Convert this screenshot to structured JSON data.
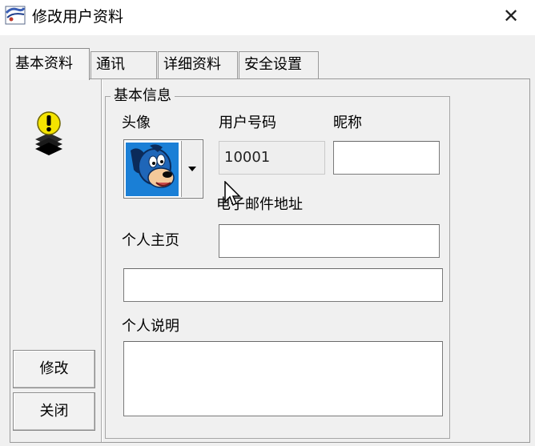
{
  "window": {
    "title": "修改用户资料",
    "close_glyph": "✕"
  },
  "tabs": [
    {
      "label": "基本资料",
      "active": true
    },
    {
      "label": "通讯",
      "active": false
    },
    {
      "label": "详细资料",
      "active": false
    },
    {
      "label": "安全设置",
      "active": false
    }
  ],
  "group": {
    "title": "基本信息"
  },
  "fields": {
    "avatar_label": "头像",
    "user_number_label": "用户号码",
    "user_number_value": "10001",
    "nickname_label": "昵称",
    "nickname_value": "",
    "email_label": "电子邮件地址",
    "email_value": "",
    "homepage_label": "个人主页",
    "homepage_value": "",
    "description_label": "个人说明",
    "description_value": ""
  },
  "buttons": {
    "modify_label": "修改",
    "close_label": "关闭"
  },
  "icons": {
    "app": "app-icon",
    "warning": "warning-bulb-icon",
    "avatar": "cartoon-dog-avatar",
    "dropdown": "chevron-down-icon"
  },
  "colors": {
    "avatar_background": "#1a7fd6",
    "warning_yellow": "#f5e400",
    "dialog_background": "#f0f0f0"
  }
}
